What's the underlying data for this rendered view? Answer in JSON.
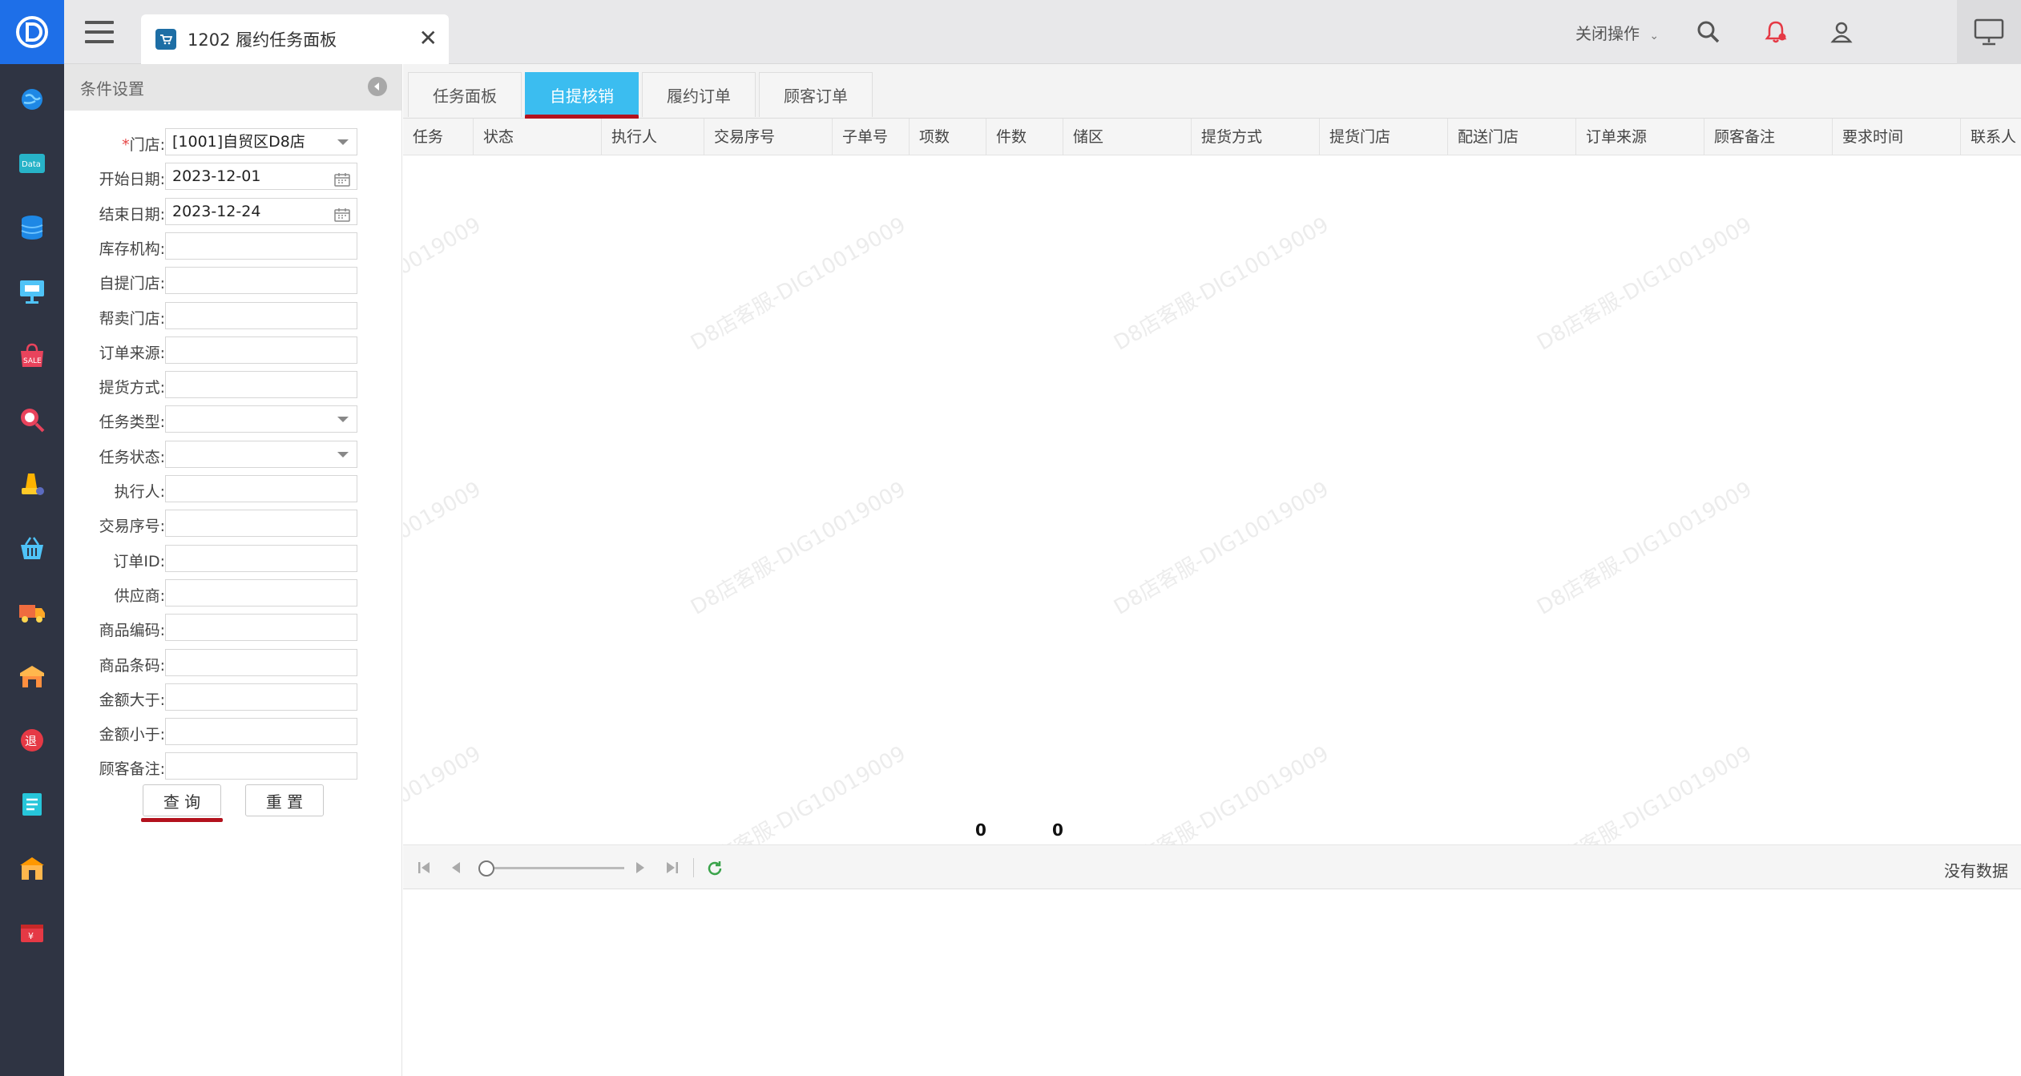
{
  "header": {
    "tab_title": "1202 履约任务面板",
    "close_ops": "关闭操作"
  },
  "colors": {
    "sidebar_bg": "#2f3443",
    "logo_bg": "#1e6fe8",
    "active_tab": "#3bbdf0",
    "highlight_underline": "#b3121d"
  },
  "sidebar": {
    "icons": [
      "globe-icon",
      "data-icon",
      "database-icon",
      "monitor-icon",
      "sale-icon",
      "search-report-icon",
      "hand-icon",
      "basket-icon",
      "truck-icon",
      "warehouse-icon",
      "return-icon",
      "ledger-icon",
      "store-icon",
      "coupon-icon"
    ]
  },
  "conditions": {
    "title": "条件设置",
    "fields": [
      {
        "label": "门店:",
        "required": true,
        "value": "[1001]自贸区D8店",
        "type": "select"
      },
      {
        "label": "开始日期:",
        "value": "2023-12-01",
        "type": "date"
      },
      {
        "label": "结束日期:",
        "value": "2023-12-24",
        "type": "date"
      },
      {
        "label": "库存机构:",
        "value": "",
        "type": "text"
      },
      {
        "label": "自提门店:",
        "value": "",
        "type": "text"
      },
      {
        "label": "帮卖门店:",
        "value": "",
        "type": "text"
      },
      {
        "label": "订单来源:",
        "value": "",
        "type": "text"
      },
      {
        "label": "提货方式:",
        "value": "",
        "type": "text"
      },
      {
        "label": "任务类型:",
        "value": "",
        "type": "select"
      },
      {
        "label": "任务状态:",
        "value": "",
        "type": "select"
      },
      {
        "label": "执行人:",
        "value": "",
        "type": "text"
      },
      {
        "label": "交易序号:",
        "value": "",
        "type": "text"
      },
      {
        "label": "订单ID:",
        "value": "",
        "type": "text"
      },
      {
        "label": "供应商:",
        "value": "",
        "type": "text"
      },
      {
        "label": "商品编码:",
        "value": "",
        "type": "text"
      },
      {
        "label": "商品条码:",
        "value": "",
        "type": "text"
      },
      {
        "label": "金额大于:",
        "value": "",
        "type": "text"
      },
      {
        "label": "金额小于:",
        "value": "",
        "type": "text"
      },
      {
        "label": "顾客备注:",
        "value": "",
        "type": "text"
      }
    ],
    "query_label": "查 询",
    "reset_label": "重 置"
  },
  "main": {
    "tabs": [
      {
        "label": "任务面板",
        "active": false
      },
      {
        "label": "自提核销",
        "active": true
      },
      {
        "label": "履约订单",
        "active": false
      },
      {
        "label": "顾客订单",
        "active": false
      }
    ],
    "columns": [
      "任务",
      "状态",
      "执行人",
      "交易序号",
      "子单号",
      "项数",
      "件数",
      "储区",
      "提货方式",
      "提货门店",
      "配送门店",
      "订单来源",
      "顾客备注",
      "要求时间",
      "联系人"
    ],
    "summary": {
      "items": "0",
      "pieces": "0"
    },
    "pager": {
      "status": "没有数据"
    },
    "watermark": "D8店客服-DIG10019009"
  }
}
